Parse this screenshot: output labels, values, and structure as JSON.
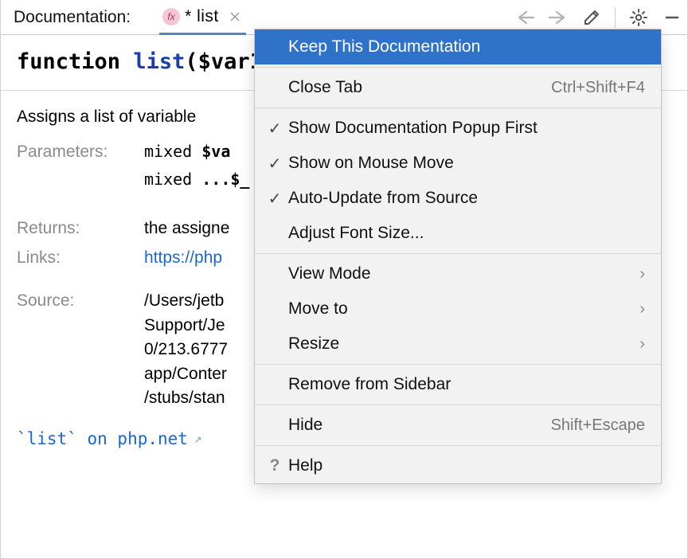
{
  "header": {
    "title": "Documentation:",
    "tab": {
      "title": "* list"
    }
  },
  "signature": {
    "keyword": "function",
    "name": " list",
    "params_display": "($var1"
  },
  "description": "Assigns a list of variable",
  "labels": {
    "parameters": "Parameters:",
    "returns": "Returns:",
    "links": "Links:",
    "source": "Source:"
  },
  "params": [
    {
      "type": "mixed",
      "name": "$va"
    },
    {
      "type": "mixed",
      "name": "...$_"
    }
  ],
  "returns": "the assigne",
  "links": [
    "https://php"
  ],
  "source": [
    "/Users/jetb",
    "Support/Je",
    "0/213.6777",
    "app/Conter",
    "/stubs/stan"
  ],
  "footer_link": {
    "text": "`list` on php.net"
  },
  "menu": {
    "items": [
      {
        "label": "Keep This Documentation",
        "selected": true
      },
      {
        "label": "Close Tab",
        "shortcut": "Ctrl+Shift+F4"
      },
      {
        "label": "Show Documentation Popup First",
        "checked": true
      },
      {
        "label": "Show on Mouse Move",
        "checked": true
      },
      {
        "label": "Auto-Update from Source",
        "checked": true
      },
      {
        "label": "Adjust Font Size..."
      },
      {
        "label": "View Mode",
        "submenu": true
      },
      {
        "label": "Move to",
        "submenu": true
      },
      {
        "label": "Resize",
        "submenu": true
      },
      {
        "label": "Remove from Sidebar"
      },
      {
        "label": "Hide",
        "shortcut": "Shift+Escape"
      },
      {
        "label": "Help"
      }
    ]
  }
}
